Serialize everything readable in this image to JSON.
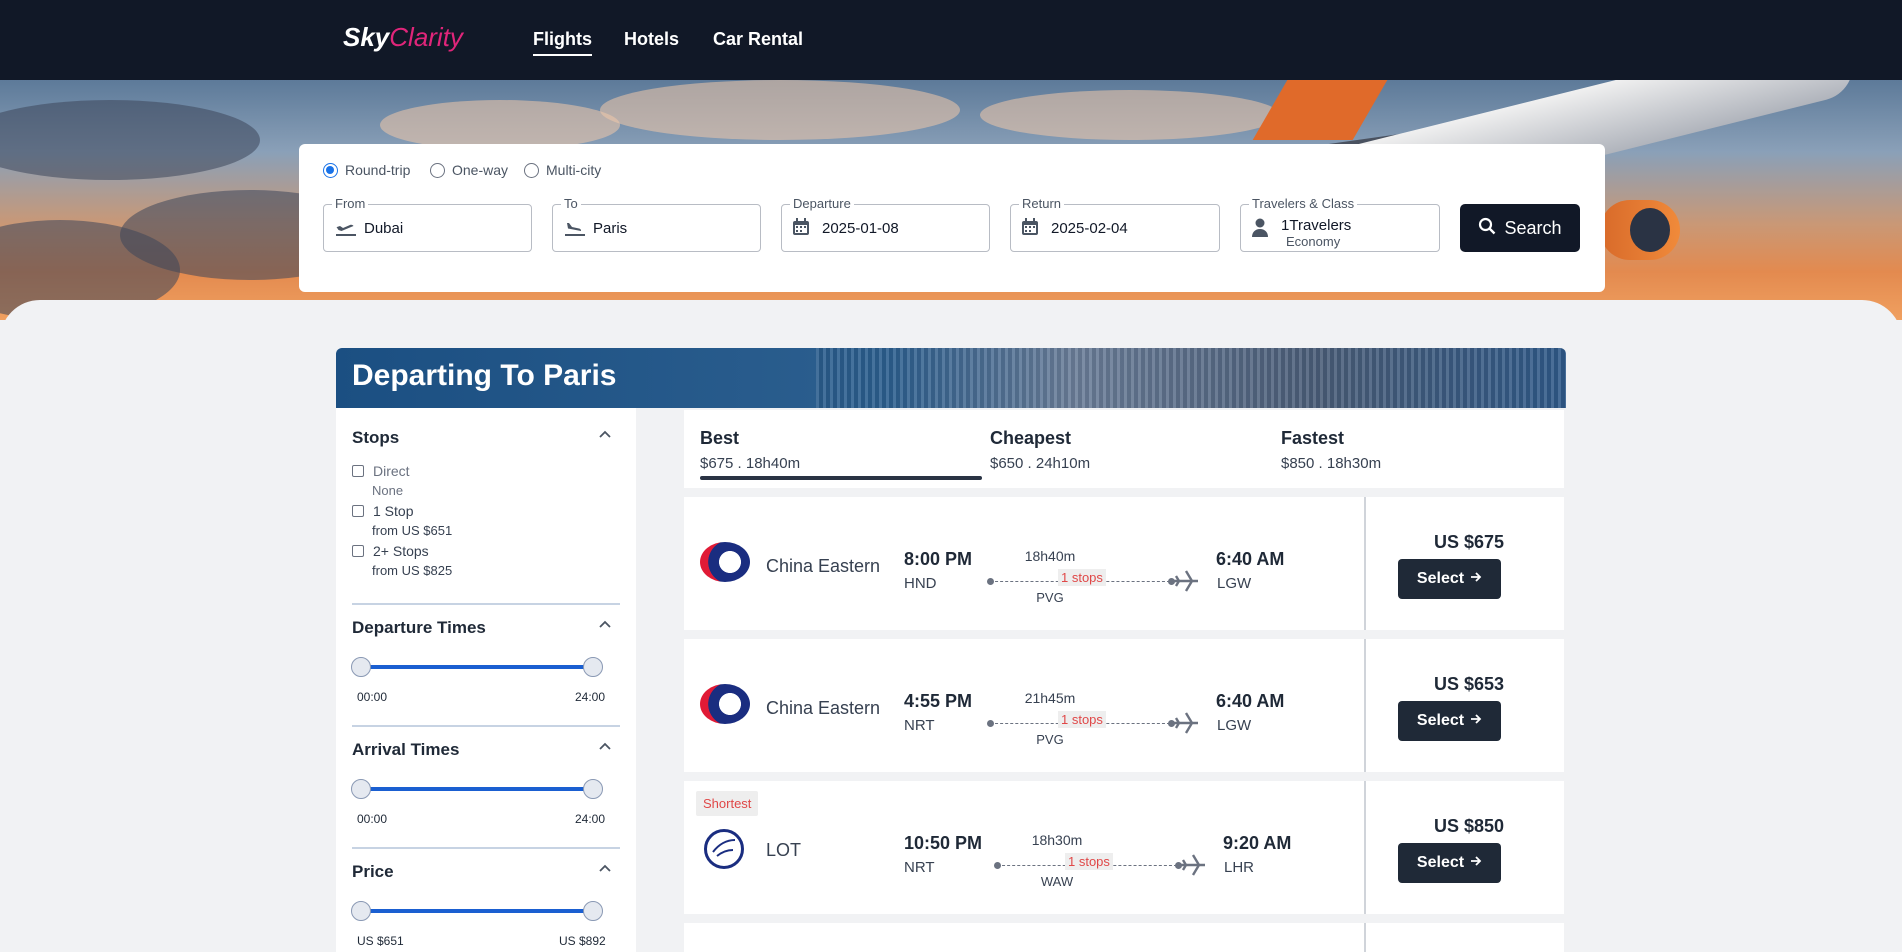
{
  "nav": {
    "logo_part1": "Sky",
    "logo_part2": "Clarity",
    "links": [
      "Flights",
      "Hotels",
      "Car Rental"
    ]
  },
  "search": {
    "trip_types": [
      "Round-trip",
      "One-way",
      "Multi-city"
    ],
    "selected_trip": "Round-trip",
    "from_label": "From",
    "from_value": "Dubai",
    "to_label": "To",
    "to_value": "Paris",
    "departure_label": "Departure",
    "departure_value": "2025-01-08",
    "return_label": "Return",
    "return_value": "2025-02-04",
    "travelers_label": "Travelers & Class",
    "travelers_value": "1Travelers",
    "class_value": "Economy",
    "search_button": "Search"
  },
  "results": {
    "title": "Departing To Paris",
    "tabs": [
      {
        "name": "Best",
        "sub": "$675 . 18h40m",
        "active": true
      },
      {
        "name": "Cheapest",
        "sub": "$650 . 24h10m",
        "active": false
      },
      {
        "name": "Fastest",
        "sub": "$850 . 18h30m",
        "active": false
      }
    ],
    "flights": [
      {
        "airline": "China Eastern",
        "dep_time": "8:00 PM",
        "dep_code": "HND",
        "duration": "18h40m",
        "stops": "1 stops",
        "via": "PVG",
        "arr_time": "6:40 AM",
        "arr_code": "LGW",
        "price": "US $675",
        "select": "Select",
        "badge": ""
      },
      {
        "airline": "China Eastern",
        "dep_time": "4:55 PM",
        "dep_code": "NRT",
        "duration": "21h45m",
        "stops": "1 stops",
        "via": "PVG",
        "arr_time": "6:40 AM",
        "arr_code": "LGW",
        "price": "US $653",
        "select": "Select",
        "badge": ""
      },
      {
        "airline": "LOT",
        "dep_time": "10:50 PM",
        "dep_code": "NRT",
        "duration": "18h30m",
        "stops": "1 stops",
        "via": "WAW",
        "arr_time": "9:20 AM",
        "arr_code": "LHR",
        "price": "US $850",
        "select": "Select",
        "badge": "Shortest"
      }
    ]
  },
  "filters": {
    "stops": {
      "title": "Stops",
      "options": [
        {
          "label": "Direct",
          "sub": "None"
        },
        {
          "label": "1 Stop",
          "sub": "from US $651"
        },
        {
          "label": "2+ Stops",
          "sub": "from US $825"
        }
      ]
    },
    "departure": {
      "title": "Departure Times",
      "min": "00:00",
      "max": "24:00"
    },
    "arrival": {
      "title": "Arrival Times",
      "min": "00:00",
      "max": "24:00"
    },
    "price": {
      "title": "Price",
      "min": "US $651",
      "max": "US $892"
    }
  },
  "icons": {
    "takeoff": "plane-departure-icon",
    "landing": "plane-arrival-icon",
    "calendar": "calendar-icon",
    "person": "person-icon",
    "search": "search-icon",
    "chevron": "chevron-up-icon",
    "arrow": "arrow-right-icon"
  },
  "colors": {
    "nav_bg": "#111827",
    "brand_pink": "#e0257a",
    "accent_blue": "#1a73e8",
    "slider_blue": "#1a5fd1",
    "stop_red": "#e04848"
  }
}
